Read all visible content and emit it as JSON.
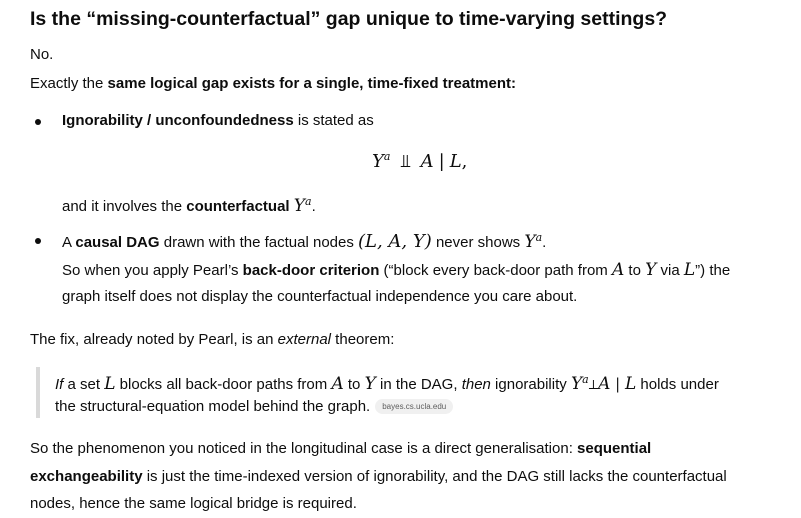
{
  "heading": "Is the “missing-counterfactual” gap unique to time-varying settings?",
  "answer": "No.",
  "intro": {
    "pre": "Exactly the ",
    "bold": "same logical gap exists for a single, time-fixed treatment:"
  },
  "bullet1": {
    "bold": "Ignorability / unconfoundedness",
    "rest": " is stated as",
    "eq_Y": "Y",
    "eq_a": "a",
    "eq_indep": "⫫",
    "eq_A": "A",
    "eq_bar": "|",
    "eq_L": "L",
    "eq_comma": ",",
    "follow_pre": "and it involves the ",
    "follow_bold": "counterfactual",
    "follow_Y": "Y",
    "follow_a": "a",
    "follow_end": "."
  },
  "bullet2": {
    "pre": "A ",
    "bold": "causal DAG",
    "mid": " drawn with the factual nodes ",
    "nodes": "(L, A, Y)",
    "post": " never shows ",
    "Y": "Y",
    "a": "a",
    "end": ".",
    "l2_pre": "So when you apply Pearl’s ",
    "l2_bold": "back-door criterion",
    "l2_mid": " (“block every back-door path from ",
    "l2_A": "A",
    "l2_to": " to ",
    "l2_Y": "Y",
    "l2_via": " via ",
    "l2_L": "L",
    "l2_end": "”) the",
    "l3": "graph itself does not display the counterfactual independence you care about."
  },
  "fix": {
    "pre": "The fix, already noted by Pearl, is an ",
    "em": "external",
    "post": " theorem:"
  },
  "quote": {
    "if": "If",
    "t1": " a set ",
    "L": "L",
    "t2": " blocks all back-door paths from ",
    "A": "A",
    "t3": " to ",
    "Y": "Y",
    "t4": " in the DAG, ",
    "then": "then",
    "t5": " ignorability ",
    "Y2": "Y",
    "a": "a",
    "perp": "⟂",
    "A2": "A",
    "bar": " | ",
    "L2": "L",
    "t6": " holds under",
    "line2": "the structural-equation model behind the graph.",
    "source": "bayes.cs.ucla.edu"
  },
  "conclusion": {
    "l1_pre": "So the phenomenon you noticed in the longitudinal case is a direct generalisation: ",
    "l1_bold": "sequential",
    "l2_bold": "exchangeability",
    "l2_rest": " is just the time-indexed version of ignorability, and the DAG still lacks the counterfactual",
    "l3": "nodes, hence the same logical bridge is required."
  }
}
